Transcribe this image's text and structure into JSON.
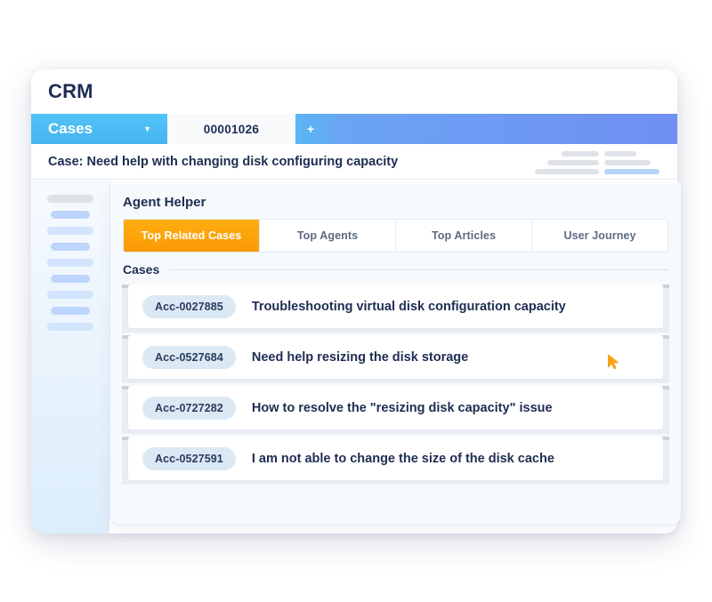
{
  "app": {
    "brand": "CRM"
  },
  "tabstrip": {
    "object_tab": "Cases",
    "caret_icon": "chevron-down-icon",
    "record_tab": "00001026",
    "add_tab": "+"
  },
  "record": {
    "title": "Case: Need help with changing disk configuring capacity",
    "skeleton": {
      "rows": [
        [
          42,
          36
        ],
        [
          58,
          52
        ],
        [
          72,
          62
        ]
      ],
      "accent_color": "#b8d4fb",
      "neutral_color": "#dfe3e8"
    }
  },
  "sidebar": {
    "items": [
      {
        "name": "nav-placeholder-1",
        "width": 52,
        "tone": "gray"
      },
      {
        "name": "nav-placeholder-2",
        "width": 44,
        "tone": "blue-d"
      },
      {
        "name": "nav-placeholder-3",
        "width": 52,
        "tone": "blue-l"
      },
      {
        "name": "nav-placeholder-4",
        "width": 44,
        "tone": "blue-d"
      },
      {
        "name": "nav-placeholder-5",
        "width": 52,
        "tone": "blue-l"
      },
      {
        "name": "nav-placeholder-6",
        "width": 44,
        "tone": "blue-d"
      },
      {
        "name": "nav-placeholder-7",
        "width": 52,
        "tone": "blue-l"
      },
      {
        "name": "nav-placeholder-8",
        "width": 44,
        "tone": "blue-d"
      },
      {
        "name": "nav-placeholder-9",
        "width": 52,
        "tone": "blue-l"
      }
    ]
  },
  "agent_helper": {
    "title": "Agent Helper",
    "tabs": [
      {
        "label": "Top Related Cases",
        "active": true
      },
      {
        "label": "Top Agents",
        "active": false
      },
      {
        "label": "Top Articles",
        "active": false
      },
      {
        "label": "User Journey",
        "active": false
      }
    ],
    "section_label": "Cases",
    "cases": [
      {
        "id": "Acc-0027885",
        "title": "Troubleshooting virtual disk configuration capacity"
      },
      {
        "id": "Acc-0527684",
        "title": "Need help resizing the disk storage"
      },
      {
        "id": "Acc-0727282",
        "title": "How to resolve the \"resizing disk capacity\" issue"
      },
      {
        "id": "Acc-0527591",
        "title": "I am not able to change the size of the disk cache"
      }
    ]
  },
  "pointer": {
    "icon": "mouse-pointer-icon",
    "color": "#faa21b"
  },
  "colors": {
    "brand_navy": "#1e2d52",
    "cases_tab_blue": "#4fc0f5",
    "tabstrip_blue": "#6f8ff2",
    "active_tab_orange": "#fb9a07",
    "badge_blue": "#dbe9f4",
    "panel_bg": "#f7fafd"
  }
}
